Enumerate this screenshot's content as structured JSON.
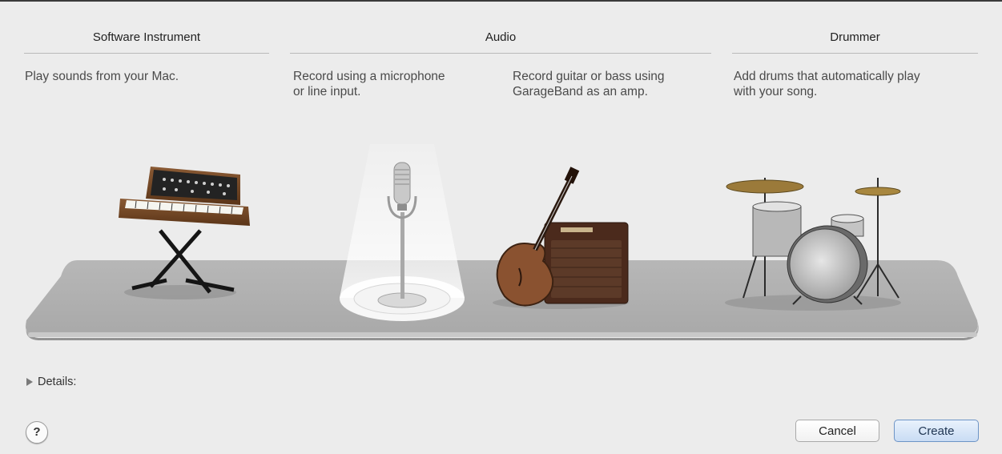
{
  "sections": {
    "software_instrument": {
      "title": "Software Instrument",
      "description": "Play sounds from your Mac."
    },
    "audio": {
      "title": "Audio",
      "microphone_description": "Record using a microphone\nor line input.",
      "guitar_description": "Record guitar or bass using\nGarageBand as an amp."
    },
    "drummer": {
      "title": "Drummer",
      "description": "Add drums that automatically play\nwith your song."
    }
  },
  "selected_option": "microphone",
  "details": {
    "label": "Details:"
  },
  "buttons": {
    "cancel": "Cancel",
    "create": "Create"
  },
  "help_button": {
    "label": "?"
  },
  "icons": {
    "keyboard": "synthesizer-keyboard-icon",
    "microphone": "microphone-icon",
    "guitar": "guitar-amp-icon",
    "drums": "drum-kit-icon"
  }
}
